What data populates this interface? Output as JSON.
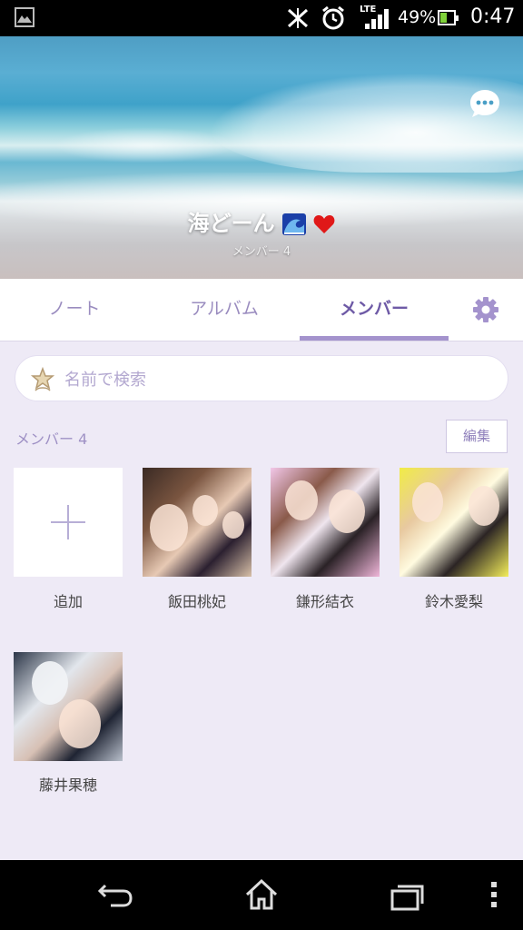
{
  "status_bar": {
    "lte": "LTE",
    "battery_percent": "49%",
    "time": "0:47",
    "battery_level": 0.49,
    "icons": [
      "image-icon",
      "nfc-icon",
      "alarm-icon",
      "signal-icon",
      "battery-icon"
    ]
  },
  "header": {
    "group_name": "海どーん",
    "member_count_label": "メンバー 4",
    "chat_icon": "chat-bubble-icon"
  },
  "tabs": [
    {
      "label": "ノート",
      "active": false
    },
    {
      "label": "アルバム",
      "active": false
    },
    {
      "label": "メンバー",
      "active": true
    }
  ],
  "settings_icon": "gear-icon",
  "search": {
    "placeholder": "名前で検索",
    "value": ""
  },
  "members_section": {
    "heading": "メンバー 4",
    "edit_label": "編集",
    "add_label": "追加",
    "members": [
      {
        "name": "飯田桃妃"
      },
      {
        "name": "鎌形結衣"
      },
      {
        "name": "鈴木愛梨"
      },
      {
        "name": "藤井果穂"
      }
    ]
  },
  "nav_bar": {
    "icons": [
      "back-icon",
      "home-icon",
      "recent-apps-icon",
      "menu-icon"
    ]
  },
  "colors": {
    "accent": "#6e5aa6",
    "tab_inactive": "#9a8cbf",
    "background": "#eeeaf6"
  }
}
